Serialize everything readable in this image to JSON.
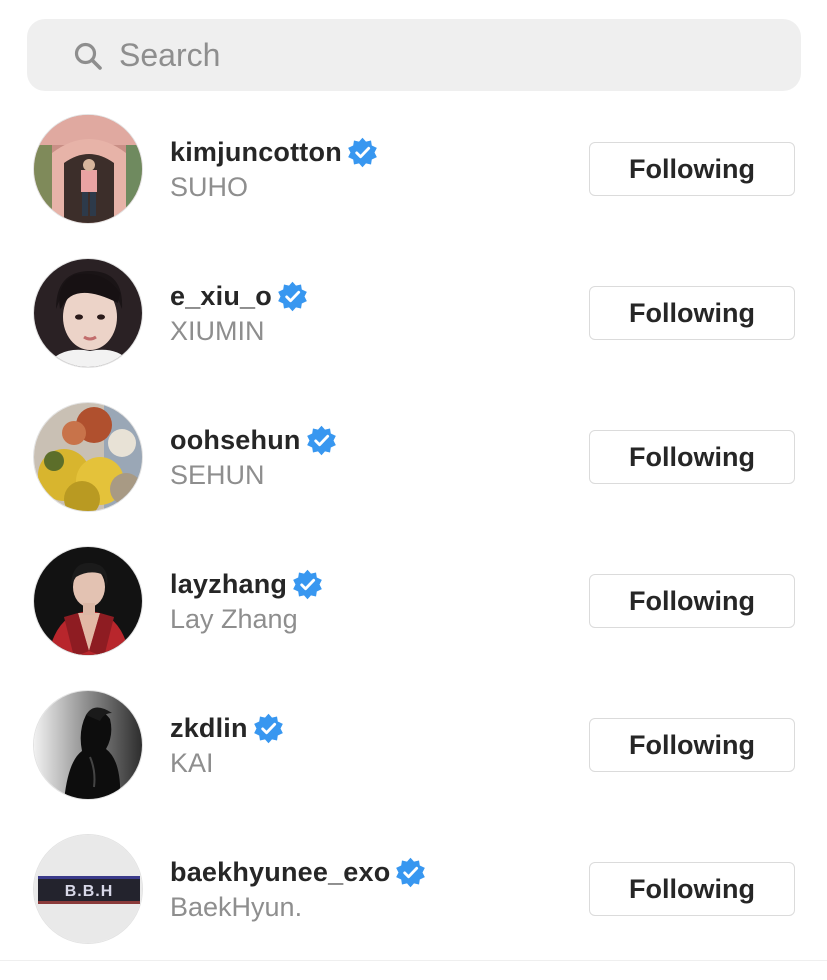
{
  "search": {
    "placeholder": "Search",
    "icon": "search-icon"
  },
  "accent_color": "#3897f0",
  "accounts": [
    {
      "username": "kimjuncotton",
      "fullname": "SUHO",
      "verified": true,
      "button_label": "Following"
    },
    {
      "username": "e_xiu_o",
      "fullname": "XIUMIN",
      "verified": true,
      "button_label": "Following"
    },
    {
      "username": "oohsehun",
      "fullname": "SEHUN",
      "verified": true,
      "button_label": "Following"
    },
    {
      "username": "layzhang",
      "fullname": "Lay Zhang",
      "verified": true,
      "button_label": "Following"
    },
    {
      "username": "zkdlin",
      "fullname": "KAI",
      "verified": true,
      "button_label": "Following"
    },
    {
      "username": "baekhyunee_exo",
      "fullname": "BaekHyun.",
      "verified": true,
      "button_label": "Following",
      "avatar_text": "B.B.H"
    }
  ]
}
